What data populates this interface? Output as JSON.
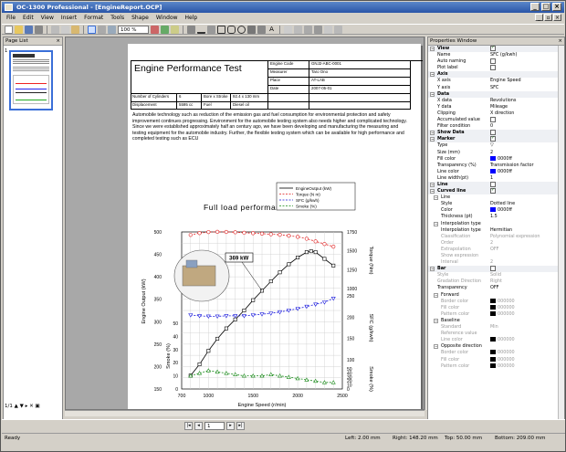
{
  "window": {
    "title": "OC-1300 Professional - [EngineReport.OCP]"
  },
  "menu": [
    "File",
    "Edit",
    "View",
    "Insert",
    "Format",
    "Tools",
    "Shape",
    "Window",
    "Help"
  ],
  "toolbar": {
    "zoom": "100 %"
  },
  "pagelist": {
    "title": "Page List",
    "page_number": "1",
    "footer": "1/1"
  },
  "document": {
    "title": "Engine Performance Test",
    "header_table": {
      "engine_code_label": "Engine Code",
      "engine_code": "GNJ2-ABC-0001",
      "measurer_label": "Measurer",
      "measurer": "Taro Ono",
      "place_label": "Place",
      "place": "AT-LAB",
      "date_label": "Date",
      "date": "2007-05-01",
      "cylinders_label": "Number of Cylinders",
      "cylinders": "6",
      "bore_label": "Bore x Stroke",
      "bore": "92.4 x 130 mm",
      "displacement_label": "Displacement",
      "displacement": "5595 cc",
      "fuel_label": "Fuel",
      "fuel": "Diesel oil"
    },
    "paragraph": "Automobile technology such as reduction of the emission gas and fuel consumption for environmental protection and safety improvement continues progressing.  Environment for the automobile testing system also needs higher and complicated technology.  Since we were established approximately half an century ago, we have been developing and manufacturing the measuring and testing equipment for the automobile industry.  Further, the flexible testing system which can be available for  high performance and completed testing such as ECU"
  },
  "chart_data": {
    "type": "line",
    "title": "Full load performance",
    "xlabel": "Engine Speed (r/min)",
    "xlim": [
      700,
      2500
    ],
    "x_ticks": [
      "700",
      "1000",
      "1500",
      "2000",
      "2500"
    ],
    "annotation": "369 kW",
    "left_axes": [
      {
        "label": "Engine Output (kW)",
        "lim": [
          150,
          500
        ],
        "ticks": [
          "150",
          "200",
          "250",
          "300",
          "350",
          "400",
          "450",
          "500"
        ]
      },
      {
        "label": "Smoke (%)",
        "lim": [
          0,
          50
        ],
        "ticks": [
          "0",
          "10",
          "20",
          "30",
          "40",
          "50"
        ]
      }
    ],
    "right_axes": [
      {
        "label": "Torque (Nm)",
        "lim": [
          1000,
          1750
        ],
        "ticks": [
          "1000",
          "1250",
          "1500",
          "1750"
        ]
      },
      {
        "label": "SFC (g/kwh)",
        "lim": [
          100,
          250
        ],
        "ticks": [
          "100",
          "150",
          "200",
          "250"
        ]
      },
      {
        "label": "Smoke (%)",
        "lim": [
          0,
          50
        ],
        "ticks": [
          "0",
          "10",
          "20",
          "30",
          "40",
          "50"
        ]
      }
    ],
    "series": [
      {
        "name": "EngineOutput (kW)",
        "color": "#000000",
        "axis": "output",
        "x": [
          800,
          900,
          1000,
          1100,
          1200,
          1300,
          1400,
          1500,
          1600,
          1700,
          1800,
          1900,
          2000,
          2100,
          2150,
          2200,
          2300,
          2400
        ],
        "y": [
          180,
          205,
          235,
          262,
          285,
          305,
          325,
          348,
          369,
          390,
          410,
          428,
          443,
          455,
          457,
          455,
          440,
          425
        ]
      },
      {
        "name": "Torque (N m)",
        "color": "#e02020",
        "axis": "torque",
        "x": [
          800,
          900,
          1000,
          1100,
          1200,
          1300,
          1400,
          1500,
          1600,
          1700,
          1800,
          1900,
          2000,
          2100,
          2200,
          2300,
          2400
        ],
        "y": [
          1710,
          1735,
          1748,
          1752,
          1750,
          1746,
          1740,
          1733,
          1727,
          1720,
          1712,
          1700,
          1685,
          1660,
          1625,
          1590,
          1555
        ]
      },
      {
        "name": "SFC (g/kwh)",
        "color": "#1a1adc",
        "axis": "sfc",
        "x": [
          800,
          900,
          1000,
          1100,
          1200,
          1300,
          1400,
          1500,
          1600,
          1700,
          1800,
          1900,
          2000,
          2100,
          2200,
          2300,
          2400
        ],
        "y": [
          205,
          203,
          202,
          202,
          203,
          203,
          203,
          205,
          207,
          209,
          212,
          216,
          220,
          225,
          230,
          235,
          244
        ]
      },
      {
        "name": "Smoke (%)",
        "color": "#1a8a1a",
        "axis": "smoke",
        "x": [
          800,
          900,
          1000,
          1100,
          1200,
          1300,
          1400,
          1500,
          1600,
          1700,
          1800,
          1900,
          2000,
          2100,
          2200,
          2300,
          2400
        ],
        "y": [
          10,
          12,
          14,
          13,
          12,
          11,
          10,
          10,
          10,
          11,
          10,
          9,
          8,
          7,
          6,
          5,
          5
        ]
      }
    ]
  },
  "properties": {
    "title": "Properties Window",
    "rows": [
      {
        "type": "sec",
        "k": "View",
        "v": "",
        "cb": true
      },
      {
        "k": "Name",
        "v": "SFC (g/kwh)"
      },
      {
        "k": "Auto naming",
        "v": "",
        "cb": false
      },
      {
        "k": "Plot label",
        "v": "",
        "cb": false
      },
      {
        "type": "sec",
        "k": "Axis",
        "v": ""
      },
      {
        "k": "X axis",
        "v": "Engine Speed"
      },
      {
        "k": "Y axis",
        "v": "SFC"
      },
      {
        "type": "sec",
        "k": "Data",
        "v": ""
      },
      {
        "k": "X data",
        "v": "Revolutions"
      },
      {
        "k": "Y data",
        "v": "Mileage"
      },
      {
        "k": "Clipping",
        "v": "X direction"
      },
      {
        "k": "Accumulated value",
        "v": "",
        "cb": false
      },
      {
        "k": "Filter condition",
        "v": "0"
      },
      {
        "type": "sec",
        "k": "Show Data",
        "v": "",
        "cb": false
      },
      {
        "type": "sec",
        "k": "Marker",
        "v": "",
        "cb": true
      },
      {
        "k": "Type",
        "v": "▽"
      },
      {
        "k": "Size (mm)",
        "v": "2"
      },
      {
        "k": "Fill color",
        "v": "0000ff",
        "sw": "#0000ff"
      },
      {
        "k": "Transparency (%)",
        "v": "Transmission factor"
      },
      {
        "k": "Line color",
        "v": "0000ff",
        "sw": "#0000ff"
      },
      {
        "k": "Line width(pt)",
        "v": "1"
      },
      {
        "type": "sec",
        "k": "Line",
        "v": "",
        "cb": false
      },
      {
        "type": "sec",
        "k": "Curved line",
        "v": "",
        "cb": true
      },
      {
        "type": "sec2",
        "k": "Line",
        "v": ""
      },
      {
        "type": "sub",
        "k": "Style",
        "v": "Dotted line"
      },
      {
        "type": "sub",
        "k": "Color",
        "v": "0000ff",
        "sw": "#0000ff"
      },
      {
        "type": "sub",
        "k": "Thickness (pt)",
        "v": "1.5"
      },
      {
        "type": "sec2",
        "k": "Interpolation type",
        "v": ""
      },
      {
        "type": "sub",
        "k": "Interpolation type",
        "v": "Hermitian"
      },
      {
        "type": "sub dim",
        "k": "Classification",
        "v": "Polynomial expression"
      },
      {
        "type": "sub dim",
        "k": "Order",
        "v": "2"
      },
      {
        "type": "sub dim",
        "k": "Extrapolation",
        "v": "OFF"
      },
      {
        "type": "sub dim",
        "k": "Show expression",
        "v": ""
      },
      {
        "type": "sub dim",
        "k": "Interval",
        "v": "2"
      },
      {
        "type": "sec",
        "k": "Bar",
        "v": "",
        "cb": false
      },
      {
        "type": "dim",
        "k": "Style",
        "v": "Solid"
      },
      {
        "type": "dim",
        "k": "Gradation Direction",
        "v": "Right"
      },
      {
        "k": "Transparency",
        "v": "OFF"
      },
      {
        "type": "sec2",
        "k": "Forward",
        "v": ""
      },
      {
        "type": "sub dim",
        "k": "Border color",
        "v": "000000",
        "sw": "#000"
      },
      {
        "type": "sub dim",
        "k": "Fill color",
        "v": "000000",
        "sw": "#000"
      },
      {
        "type": "sub dim",
        "k": "Pattern color",
        "v": "000000",
        "sw": "#000"
      },
      {
        "type": "sec2",
        "k": "Baseline",
        "v": ""
      },
      {
        "type": "sub dim",
        "k": "Standard",
        "v": "Min"
      },
      {
        "type": "sub dim",
        "k": "Reference value",
        "v": ""
      },
      {
        "type": "sub dim",
        "k": "Line color",
        "v": "000000",
        "sw": "#000"
      },
      {
        "type": "sec2",
        "k": "Opposite direction",
        "v": ""
      },
      {
        "type": "sub dim",
        "k": "Border color",
        "v": "000000",
        "sw": "#000"
      },
      {
        "type": "sub dim",
        "k": "Fill color",
        "v": "000000",
        "sw": "#000"
      },
      {
        "type": "sub dim",
        "k": "Pattern color",
        "v": "000000",
        "sw": "#000"
      }
    ]
  },
  "navigation": {
    "page": "1"
  },
  "status": {
    "ready": "Ready",
    "left": "Left:  2.00 mm",
    "right": "Right:  148.20 mm",
    "top": "Top:  50.00 mm",
    "bottom": "Bottom:  209.00 mm"
  }
}
